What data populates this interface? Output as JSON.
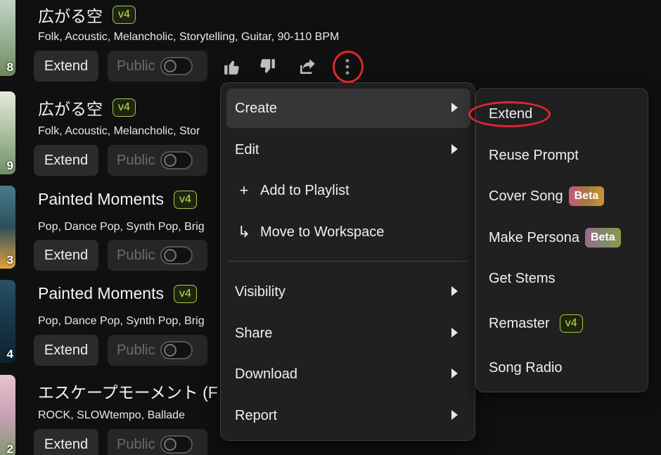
{
  "songs": [
    {
      "title": "広がる空",
      "version": "v4",
      "tags": "Folk, Acoustic, Melancholic, Storytelling, Guitar, 90-110 BPM",
      "thumb_number": "8",
      "thumb_gradient": "linear-gradient(180deg,#c9d8d0,#9bb59a,#6d8a5c)"
    },
    {
      "title": "広がる空",
      "version": "v4",
      "tags": "Folk, Acoustic, Melancholic, Stor",
      "thumb_number": "9",
      "thumb_gradient": "linear-gradient(180deg,#e6ebe0,#a9c0a0,#708e6a)"
    },
    {
      "title": "Painted Moments",
      "version": "v4",
      "tags": "Pop, Dance Pop, Synth Pop, Brig",
      "thumb_number": "3",
      "thumb_gradient": "linear-gradient(180deg,#4a7a8a,#2d4f5c,#e2a33a)"
    },
    {
      "title": "Painted Moments",
      "version": "v4",
      "tags": "Pop, Dance Pop, Synth Pop, Brig",
      "thumb_number": "4",
      "thumb_gradient": "linear-gradient(180deg,#2a5266,#173648,#0f2230)"
    },
    {
      "title": "エスケープモーメント (F",
      "version": "",
      "tags": "ROCK, SLOWtempo, Ballade",
      "thumb_number": "2",
      "thumb_gradient": "linear-gradient(180deg,#e8c3cf,#c7a0b4,#7d9a6a)"
    }
  ],
  "song_buttons": {
    "extend": "Extend",
    "public": "Public"
  },
  "context_menu": {
    "items": [
      {
        "label": "Create"
      },
      {
        "label": "Edit"
      },
      {
        "label": "Add to Playlist",
        "icon": "+"
      },
      {
        "label": "Move to Workspace",
        "icon": "↳"
      },
      {
        "label": "Visibility"
      },
      {
        "label": "Share"
      },
      {
        "label": "Download"
      },
      {
        "label": "Report"
      }
    ]
  },
  "create_submenu": {
    "items": [
      {
        "label": "Extend"
      },
      {
        "label": "Reuse Prompt"
      },
      {
        "label": "Cover Song",
        "badge": "Beta"
      },
      {
        "label": "Make Persona",
        "badge": "Beta"
      },
      {
        "label": "Get Stems"
      },
      {
        "label": "Remaster",
        "badge": "v4"
      },
      {
        "label": "Song Radio"
      }
    ]
  },
  "colors": {
    "accent_green": "#b8e34a",
    "annotation_red": "#e0262e",
    "menu_bg": "#202020"
  }
}
